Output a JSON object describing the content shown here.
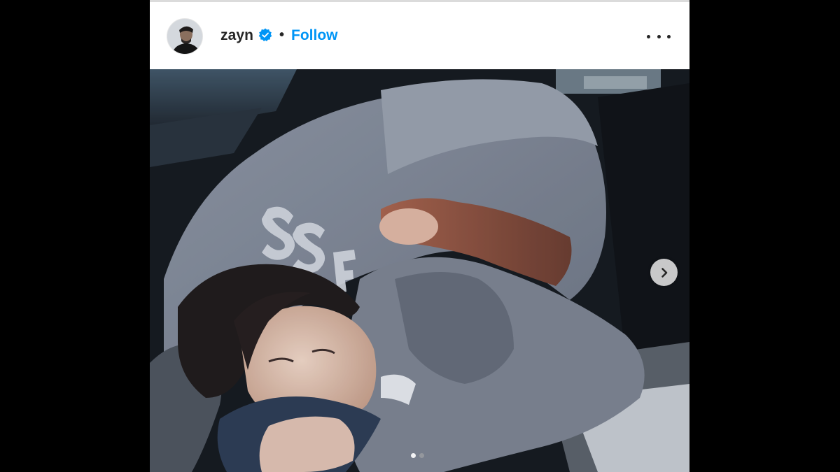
{
  "post": {
    "username": "zayn",
    "verified": true,
    "separator": "•",
    "follow_label": "Follow",
    "more_icon": "more-options-icon",
    "carousel": {
      "slide_count": 2,
      "active_index": 0,
      "next_icon": "chevron-right-icon"
    },
    "photo_description_icon": "photo"
  },
  "colors": {
    "follow_blue": "#0095f6",
    "verified_blue": "#0095f6",
    "text_dark": "#262626",
    "dot_active": "#ffffff",
    "dot_inactive": "#a8a8a8"
  }
}
